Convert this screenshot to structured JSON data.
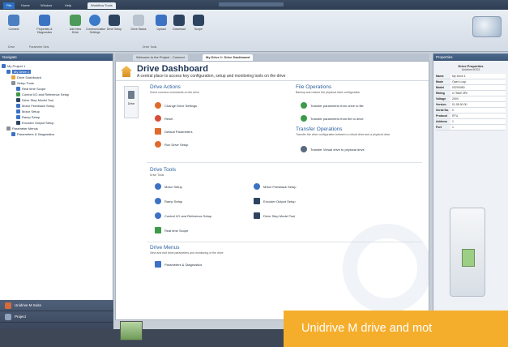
{
  "ribbon": {
    "tabs": [
      {
        "label": "File"
      },
      {
        "label": "Home"
      },
      {
        "label": "Window"
      },
      {
        "label": "Help"
      },
      {
        "label": "Workflow Tools"
      }
    ],
    "buttons": [
      {
        "label": "Connect"
      },
      {
        "label": "Properties & Diagnostics"
      },
      {
        "label": "Add New Drive"
      },
      {
        "label": "Communication Settings"
      },
      {
        "label": "Drive Setup"
      },
      {
        "label": "Drive Status"
      },
      {
        "label": "Upload"
      },
      {
        "label": "Download"
      },
      {
        "label": "Scope"
      }
    ],
    "groups": [
      "Drive",
      "Parameter Sets",
      "Drive Tools"
    ]
  },
  "nav": {
    "title": "Navigate",
    "tree": [
      {
        "label": "My Project 1",
        "level": 0,
        "icon_color": "#3c72c4"
      },
      {
        "label": "My Drive 1",
        "level": 1,
        "icon_color": "#3c72c4",
        "selected": true
      },
      {
        "label": "Drive Dashboard",
        "level": 2,
        "icon_color": "#e8a43a"
      },
      {
        "label": "Setup Tools",
        "level": 2,
        "icon_color": "#8a8f96"
      },
      {
        "label": "Real time Scope",
        "level": 3,
        "icon_color": "#3c72c4"
      },
      {
        "label": "Control I/O and Reference Setup",
        "level": 3,
        "icon_color": "#3c9a4a"
      },
      {
        "label": "Drive Step Model Tool",
        "level": 3,
        "icon_color": "#2d4460"
      },
      {
        "label": "Motor Feedback Setup",
        "level": 3,
        "icon_color": "#3c72c4"
      },
      {
        "label": "Motor Setup",
        "level": 3,
        "icon_color": "#3c72c4"
      },
      {
        "label": "Ramp Setup",
        "level": 3,
        "icon_color": "#3c72c4"
      },
      {
        "label": "Encoder Output Setup",
        "level": 3,
        "icon_color": "#2d4460"
      },
      {
        "label": "Parameter Menus",
        "level": 1,
        "icon_color": "#8a8f96"
      },
      {
        "label": "Parameters & Diagnostics",
        "level": 2,
        "icon_color": "#3c72c4"
      }
    ],
    "bottom": [
      {
        "label": "Unidrive M Suite",
        "icon_color": "#d86b3c"
      },
      {
        "label": "Project",
        "icon_color": "#8fa3bd"
      }
    ]
  },
  "doc_tabs": [
    {
      "label": "Welcome to the Project - Connect"
    },
    {
      "label": "My Drive 1: Drive Dashboard"
    }
  ],
  "dashboard": {
    "title": "Drive Dashboard",
    "subtitle": "A central place to access key configuration, setup and monitoring tools on the drive",
    "side_button": "Drive",
    "sections": {
      "drive_actions": {
        "title": "Drive Actions",
        "desc": "Some common commands on the drive",
        "items": [
          {
            "label": "Change Drive Settings",
            "icon_color": "#e06a2b"
          },
          {
            "label": "Reset",
            "icon_color": "#d94c3a"
          },
          {
            "label": "Default Parameters",
            "icon_color": "#e06a2b"
          },
          {
            "label": "Run Drive Setup",
            "icon_color": "#e06a2b"
          }
        ]
      },
      "file_operations": {
        "title": "File Operations",
        "desc": "Backup and restore the physical drive configuration",
        "items": [
          {
            "label": "Transfer parameters from drive to file",
            "icon_color": "#3c9a4a"
          },
          {
            "label": "Transfer parameters from file to drive",
            "icon_color": "#3c9a4a"
          }
        ]
      },
      "transfer_operations": {
        "title": "Transfer Operations",
        "desc": "Transfer the drive configuration between a virtual drive and a physical drive",
        "items": [
          {
            "label": "Transfer Virtual drive to physical drive",
            "icon_color": "#5a6a7d"
          }
        ]
      },
      "drive_tools": {
        "title": "Drive Tools",
        "desc": "Drive Tools",
        "items": [
          {
            "label": "Motor Setup",
            "icon_color": "#3c72c4"
          },
          {
            "label": "Motor Feedback Setup",
            "icon_color": "#3c72c4"
          },
          {
            "label": "Ramp Setup",
            "icon_color": "#3c72c4"
          },
          {
            "label": "Encoder Output Setup",
            "icon_color": "#2d4460"
          },
          {
            "label": "Control I/O and Reference Setup",
            "icon_color": "#3c72c4"
          },
          {
            "label": "Drive Step Model Tool",
            "icon_color": "#2d4460"
          },
          {
            "label": "Real time Scope",
            "icon_color": "#3c9a4a"
          }
        ]
      },
      "drive_menus": {
        "title": "Drive Menus",
        "desc": "View and edit drive parameters and monitoring of the drive",
        "items": [
          {
            "label": "Parameters & Diagnostics",
            "icon_color": "#3c72c4"
          }
        ]
      }
    }
  },
  "properties": {
    "title": "Properties",
    "heading": "Drive Properties",
    "subheading": "Unidrive M702",
    "rows": [
      {
        "key": "Name",
        "value": "My Drive 1"
      },
      {
        "key": "Mode",
        "value": "Open Loop"
      },
      {
        "key": "Model",
        "value": "03200050"
      },
      {
        "key": "Rating",
        "value": "0.75kW 3Ph"
      },
      {
        "key": "Voltage",
        "value": "200V"
      },
      {
        "key": "Version",
        "value": "01.05.00.00"
      },
      {
        "key": "Serial No.",
        "value": "0"
      },
      {
        "key": "Protocol",
        "value": "RTU"
      },
      {
        "key": "Address",
        "value": "1"
      },
      {
        "key": "Port",
        "value": "1"
      }
    ]
  },
  "caption": "Unidrive M drive and mot"
}
